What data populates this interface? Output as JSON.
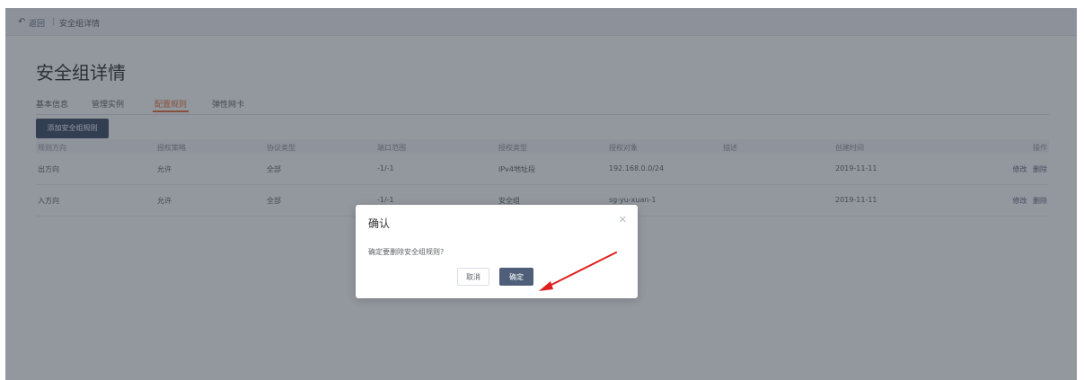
{
  "breadcrumb": {
    "back_label": "返回",
    "separator": "|",
    "current": "安全组详情"
  },
  "page": {
    "title": "安全组详情"
  },
  "tabs": [
    {
      "label": "基本信息",
      "active": false
    },
    {
      "label": "管理实例",
      "active": false
    },
    {
      "label": "配置规则",
      "active": true
    },
    {
      "label": "弹性网卡",
      "active": false
    }
  ],
  "toolbar": {
    "add_rule_label": "添加安全组规则"
  },
  "table": {
    "columns": [
      "规则方向",
      "授权策略",
      "协议类型",
      "端口范围",
      "授权类型",
      "授权对象",
      "描述",
      "创建时间",
      "操作"
    ],
    "rows": [
      {
        "direction": "出方向",
        "policy": "允许",
        "protocol": "全部",
        "port": "-1/-1",
        "auth_type": "IPv4地址段",
        "auth_object": "192.168.0.0/24",
        "description": "",
        "created": "2019-11-11",
        "edit": "修改",
        "delete": "删除"
      },
      {
        "direction": "入方向",
        "policy": "允许",
        "protocol": "全部",
        "port": "-1/-1",
        "auth_type": "安全组",
        "auth_object": "sg-yu-xuan-1",
        "description": "",
        "created": "2019-11-11",
        "edit": "修改",
        "delete": "删除"
      }
    ]
  },
  "dialog": {
    "title": "确认",
    "message": "确定要删除安全组规则?",
    "cancel_label": "取消",
    "confirm_label": "确定"
  },
  "annotation": {
    "arrow_color": "#e02020"
  }
}
